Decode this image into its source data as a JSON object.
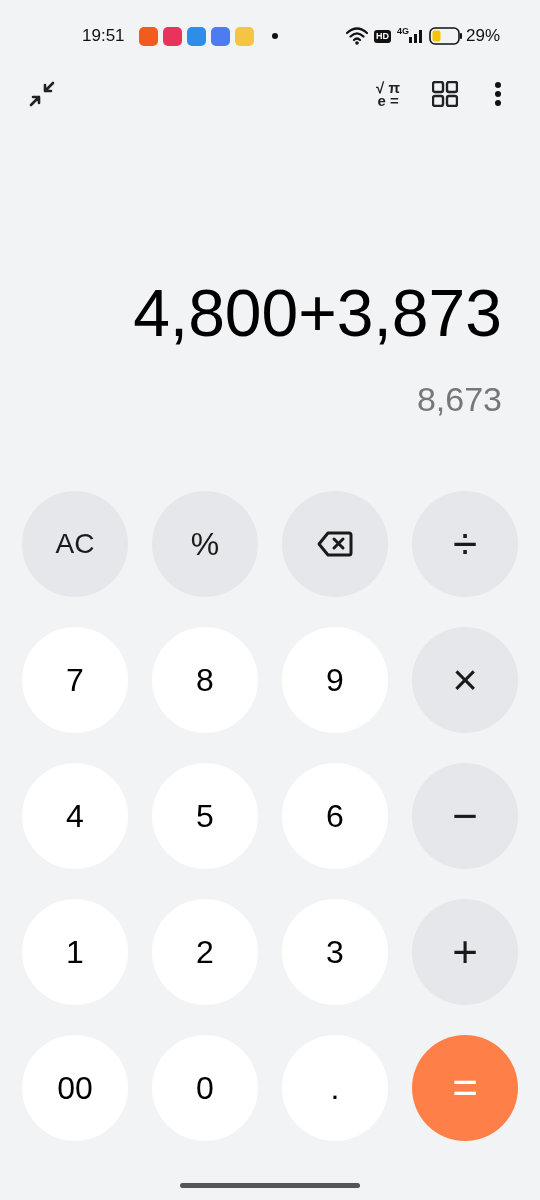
{
  "status_bar": {
    "time": "19:51",
    "app_icons": [
      {
        "color": "#f25a1e"
      },
      {
        "color": "#e8335a"
      },
      {
        "color": "#2e8de6"
      },
      {
        "color": "#4b7cf0"
      },
      {
        "color": "#f5c542"
      }
    ],
    "network": [
      "HD",
      "4G"
    ],
    "battery": "29%"
  },
  "toolbar": {
    "scientific": [
      "√ π",
      "e ="
    ]
  },
  "display": {
    "expression": "4,800+3,873",
    "result": "8,673"
  },
  "keys": [
    {
      "kind": "function",
      "label": "AC"
    },
    {
      "kind": "function",
      "label": "%"
    },
    {
      "kind": "backspace"
    },
    {
      "kind": "function",
      "label": "÷"
    },
    {
      "kind": "digit",
      "label": "7"
    },
    {
      "kind": "digit",
      "label": "8"
    },
    {
      "kind": "digit",
      "label": "9"
    },
    {
      "kind": "function",
      "label": "×"
    },
    {
      "kind": "digit",
      "label": "4"
    },
    {
      "kind": "digit",
      "label": "5"
    },
    {
      "kind": "digit",
      "label": "6"
    },
    {
      "kind": "function",
      "label": "−"
    },
    {
      "kind": "digit",
      "label": "1"
    },
    {
      "kind": "digit",
      "label": "2"
    },
    {
      "kind": "digit",
      "label": "3"
    },
    {
      "kind": "function",
      "label": "+"
    },
    {
      "kind": "digit",
      "label": "00"
    },
    {
      "kind": "digit",
      "label": "0"
    },
    {
      "kind": "digit",
      "label": "."
    },
    {
      "kind": "equals",
      "label": "="
    }
  ]
}
